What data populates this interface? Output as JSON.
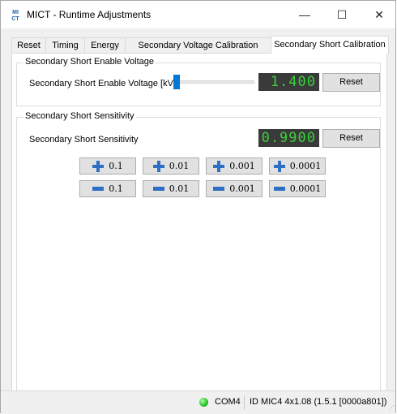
{
  "window": {
    "title": "MICT - Runtime Adjustments",
    "app_icon_text": "MI CT",
    "minimize_glyph": "—",
    "maximize_glyph": "☐",
    "close_glyph": "✕"
  },
  "tabs": [
    {
      "label": "Reset",
      "active": false
    },
    {
      "label": "Timing",
      "active": false
    },
    {
      "label": "Energy",
      "active": false
    },
    {
      "label": "Secondary Voltage Calibration",
      "active": false
    },
    {
      "label": "Secondary Short Calibration",
      "active": true
    }
  ],
  "enable_voltage": {
    "group_title": "Secondary Short Enable Voltage",
    "label": "Secondary Short Enable Voltage [kV]",
    "display_value": "1.400",
    "slider_fraction": 0.0,
    "reset_label": "Reset"
  },
  "sensitivity": {
    "group_title": "Secondary Short Sensitivity",
    "label": "Secondary Short Sensitivity",
    "display_value": "0.9900",
    "reset_label": "Reset",
    "increment_buttons": [
      "0.1",
      "0.01",
      "0.001",
      "0.0001"
    ],
    "decrement_buttons": [
      "0.1",
      "0.01",
      "0.001",
      "0.0001"
    ]
  },
  "status": {
    "led_color": "#22c322",
    "port": "COM4",
    "device_id": "ID MIC4 4x1.08 (1.5.1 [0000a801])"
  },
  "colors": {
    "accent": "#0078d7",
    "lcd_bg": "#3a3a3a",
    "lcd_fg": "#3ad13a",
    "step_icon": "#2e6fc3"
  }
}
